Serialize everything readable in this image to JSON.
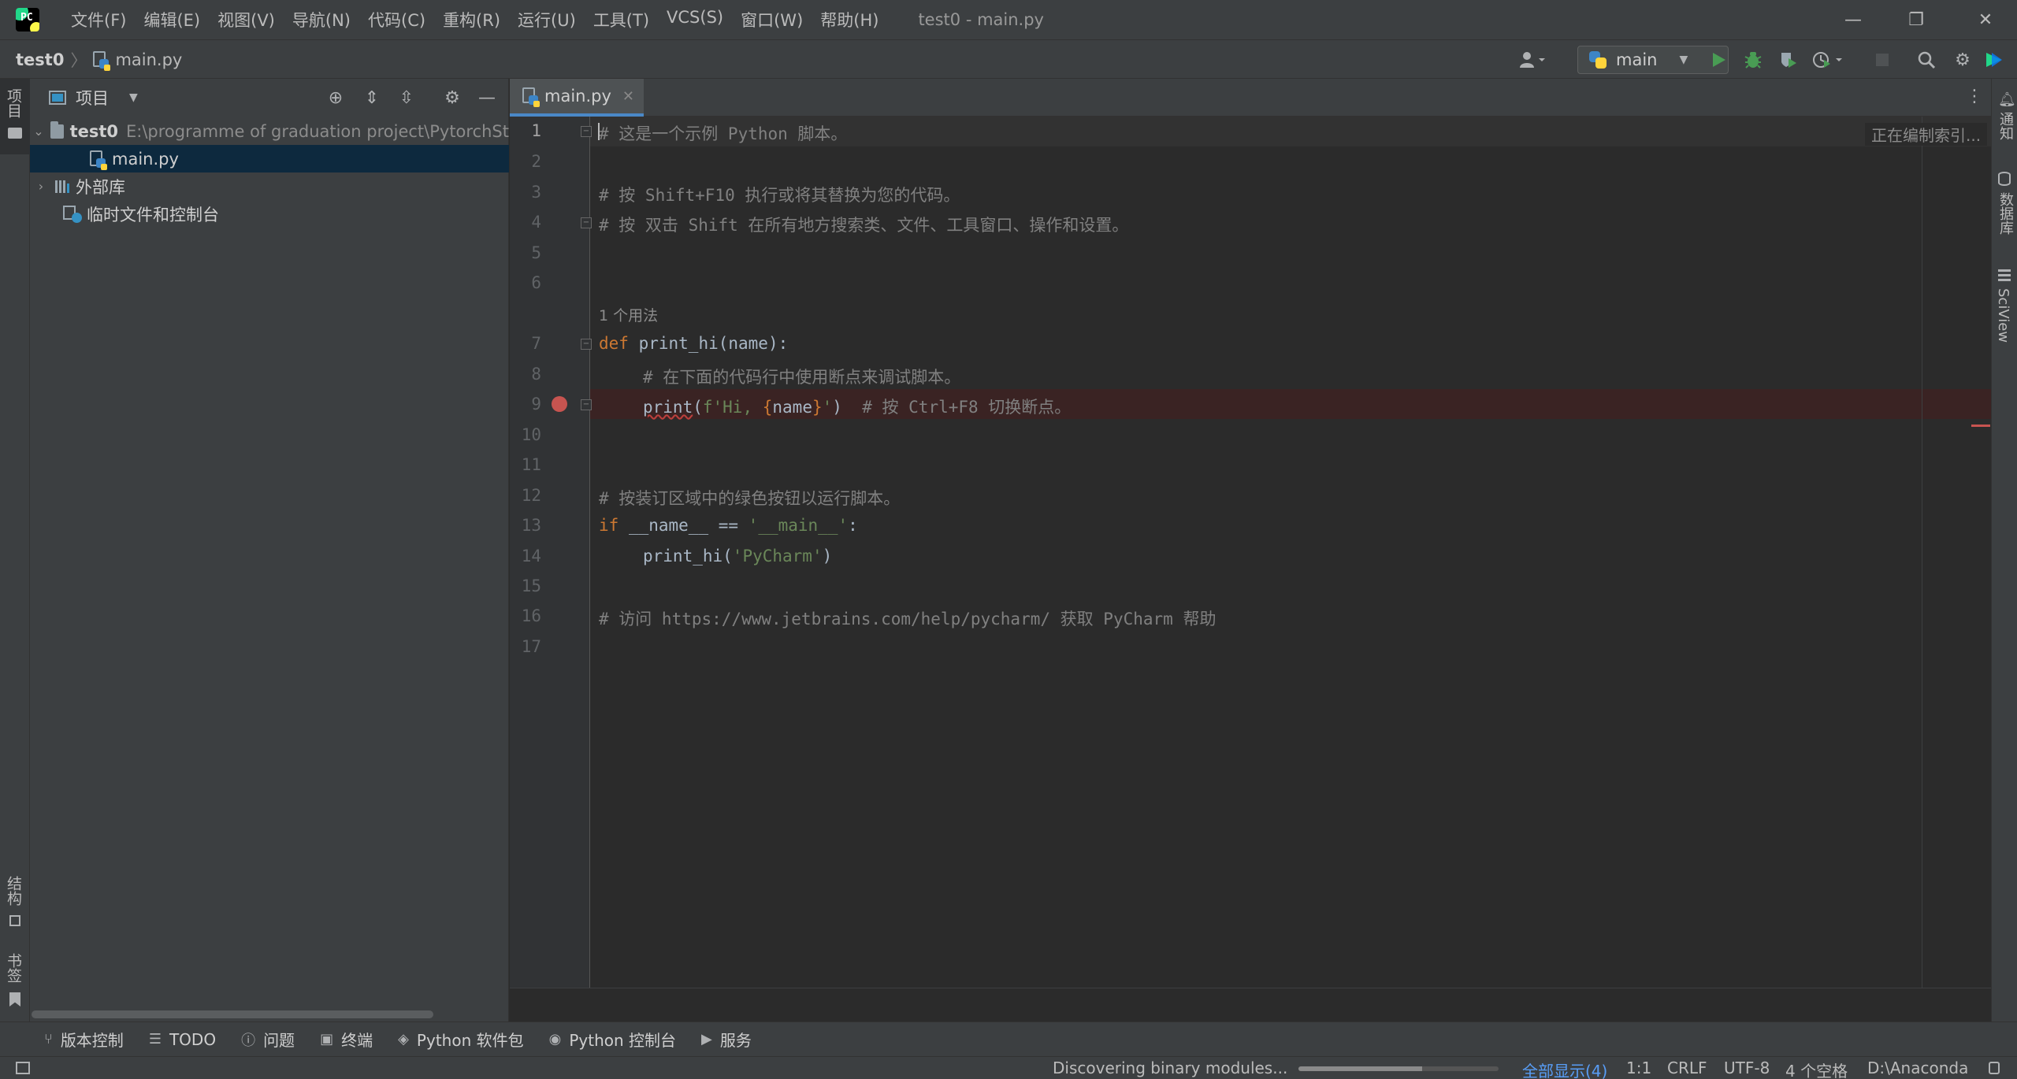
{
  "app": {
    "logo_text": "PC",
    "menu": [
      "文件(F)",
      "编辑(E)",
      "视图(V)",
      "导航(N)",
      "代码(C)",
      "重构(R)",
      "运行(U)",
      "工具(T)",
      "VCS(S)",
      "窗口(W)",
      "帮助(H)"
    ],
    "window_title": "test0 - main.py",
    "window_controls": {
      "minimize": "—",
      "restore": "❐",
      "close": "✕"
    }
  },
  "navbar": {
    "project": "test0",
    "separator": "〉",
    "file": "main.py",
    "run_config": "main"
  },
  "left_stripe": {
    "project_tab": "项目",
    "structure_tab": "结构",
    "bookmarks_tab": "书签"
  },
  "project_panel": {
    "title": "项目",
    "tree": {
      "root": {
        "name": "test0",
        "path": "E:\\programme of graduation project\\PytorchSt"
      },
      "file": "main.py",
      "ext_libs": "外部库",
      "scratches": "临时文件和控制台"
    }
  },
  "editor": {
    "tab_label": "main.py",
    "tab_close": "✕",
    "indexing": "正在编制索引...",
    "usage_hint": "1 个用法",
    "line_numbers": [
      "1",
      "2",
      "3",
      "4",
      "5",
      "6",
      "7",
      "8",
      "9",
      "10",
      "11",
      "12",
      "13",
      "14",
      "15",
      "16",
      "17"
    ],
    "lines": {
      "l1": "# 这是一个示例 Python 脚本。",
      "l3": "# 按 Shift+F10 执行或将其替换为您的代码。",
      "l4": "# 按 双击 Shift 在所有地方搜索类、文件、工具窗口、操作和设置。",
      "l7_kw": "def",
      "l7_rest": " print_hi(name):",
      "l8": "# 在下面的代码行中使用断点来调试脚本。",
      "l9_fn": "print",
      "l9_p1": "(",
      "l9_str1": "f'Hi, ",
      "l9_brace1": "{",
      "l9_name": "name",
      "l9_brace2": "}",
      "l9_str2": "'",
      "l9_p2": ")",
      "l9_cmt": "  # 按 Ctrl+F8 切换断点。",
      "l12": "# 按装订区域中的绿色按钮以运行脚本。",
      "l13_kw": "if",
      "l13_mid": " __name__ == ",
      "l13_str": "'__main__'",
      "l13_end": ":",
      "l14_a": "print_hi(",
      "l14_str": "'PyCharm'",
      "l14_b": ")",
      "l16": "# 访问 https://www.jetbrains.com/help/pycharm/ 获取 PyCharm 帮助"
    },
    "breakpoint_line": 9
  },
  "right_stripe": {
    "notifications": "通知",
    "database": "数据库",
    "sciview": "SciView"
  },
  "bottom_tools": [
    {
      "icon": "vcs-icon",
      "glyph": "⑂",
      "label": "版本控制"
    },
    {
      "icon": "todo-icon",
      "glyph": "☰",
      "label": "TODO"
    },
    {
      "icon": "problems-icon",
      "glyph": "ⓘ",
      "label": "问题"
    },
    {
      "icon": "terminal-icon",
      "glyph": "▣",
      "label": "终端"
    },
    {
      "icon": "packages-icon",
      "glyph": "◈",
      "label": "Python 软件包"
    },
    {
      "icon": "python-console-icon",
      "glyph": "◉",
      "label": "Python 控制台"
    },
    {
      "icon": "services-icon",
      "glyph": "▶",
      "label": "服务"
    }
  ],
  "status": {
    "message": "Discovering binary modules...",
    "progress": 0.62,
    "show_all": "全部显示(4)",
    "position": "1:1",
    "line_ending": "CRLF",
    "encoding": "UTF-8",
    "indent": "4 个空格",
    "interpreter": "D:\\Anaconda"
  },
  "colors": {
    "accent": "#4a88c7",
    "breakpoint": "#c75450",
    "selection": "#0d293e",
    "keyword": "#cc7832",
    "string": "#6a8759",
    "comment": "#808080"
  }
}
